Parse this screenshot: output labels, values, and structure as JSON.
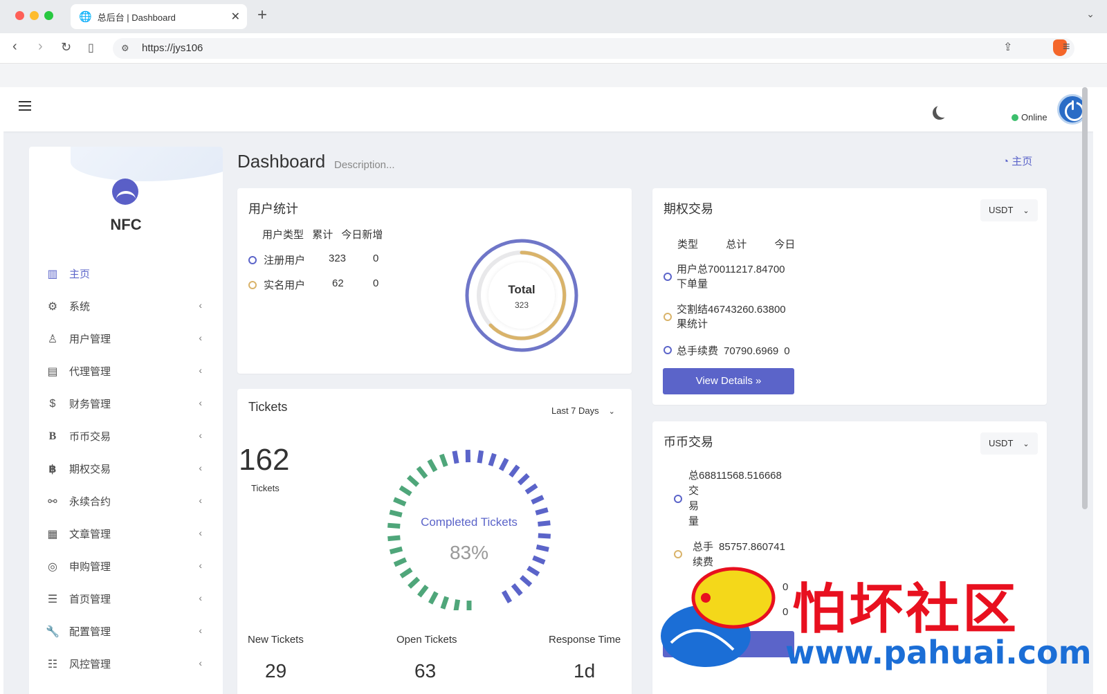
{
  "browser": {
    "tab_title": "总后台 | Dashboard",
    "url": "https://jys106"
  },
  "header": {
    "status": "Online"
  },
  "sidebar": {
    "brand": "NFC",
    "items": [
      {
        "label": "主页",
        "icon": "bar-chart-icon"
      },
      {
        "label": "系统",
        "icon": "gear-icon"
      },
      {
        "label": "用户管理",
        "icon": "user-icon"
      },
      {
        "label": "代理管理",
        "icon": "id-card-icon"
      },
      {
        "label": "财务管理",
        "icon": "dollar-icon"
      },
      {
        "label": "币币交易",
        "icon": "bold-b-icon"
      },
      {
        "label": "期权交易",
        "icon": "bitcoin-icon"
      },
      {
        "label": "永续合约",
        "icon": "link-icon"
      },
      {
        "label": "文章管理",
        "icon": "newspaper-icon"
      },
      {
        "label": "申购管理",
        "icon": "lifebuoy-icon"
      },
      {
        "label": "首页管理",
        "icon": "list-icon"
      },
      {
        "label": "配置管理",
        "icon": "wrench-icon"
      },
      {
        "label": "风控管理",
        "icon": "indent-list-icon"
      }
    ]
  },
  "page": {
    "title": "Dashboard",
    "description": "Description...",
    "breadcrumb": "主页"
  },
  "user_stats": {
    "title": "用户统计",
    "headers": [
      "用户类型",
      "累计",
      "今日新增"
    ],
    "rows": [
      {
        "type": "注册用户",
        "total": "323",
        "today": "0"
      },
      {
        "type": "实名用户",
        "total": "62",
        "today": "0"
      }
    ],
    "donut_label": "Total",
    "donut_value": "323"
  },
  "options": {
    "title": "期权交易",
    "currency": "USDT",
    "headers": [
      "类型",
      "总计",
      "今日"
    ],
    "rows": [
      {
        "l1": "用户总",
        "value": "70011217.84700",
        "l2": "下单量"
      },
      {
        "l1": "交割结",
        "value": "46743260.63800",
        "l2": "果统计"
      },
      {
        "l1": "总手续费",
        "value": "70790.6969",
        "extra": "0"
      }
    ],
    "button": "View Details »"
  },
  "spot": {
    "title": "币币交易",
    "currency": "USDT",
    "r1_prefix": "总",
    "r1_value": "68811568.516668",
    "r1_chars": [
      "交",
      "易",
      "量"
    ],
    "r2_l1": "总手",
    "r2_value": "85757.860741",
    "r2_l2": "续费",
    "v3": "0",
    "v4": "0"
  },
  "tickets": {
    "title": "Tickets",
    "range": "Last 7 Days",
    "count": "162",
    "count_label": "Tickets",
    "gauge_label": "Completed Tickets",
    "gauge_value": "83%",
    "gauge_fraction": 0.83,
    "stats": [
      {
        "label": "New Tickets",
        "value": "29"
      },
      {
        "label": "Open Tickets",
        "value": "63"
      },
      {
        "label": "Response Time",
        "value": "1d"
      }
    ]
  },
  "watermark": {
    "cn": "怕坏社区",
    "url": "www.pahuai.com"
  }
}
